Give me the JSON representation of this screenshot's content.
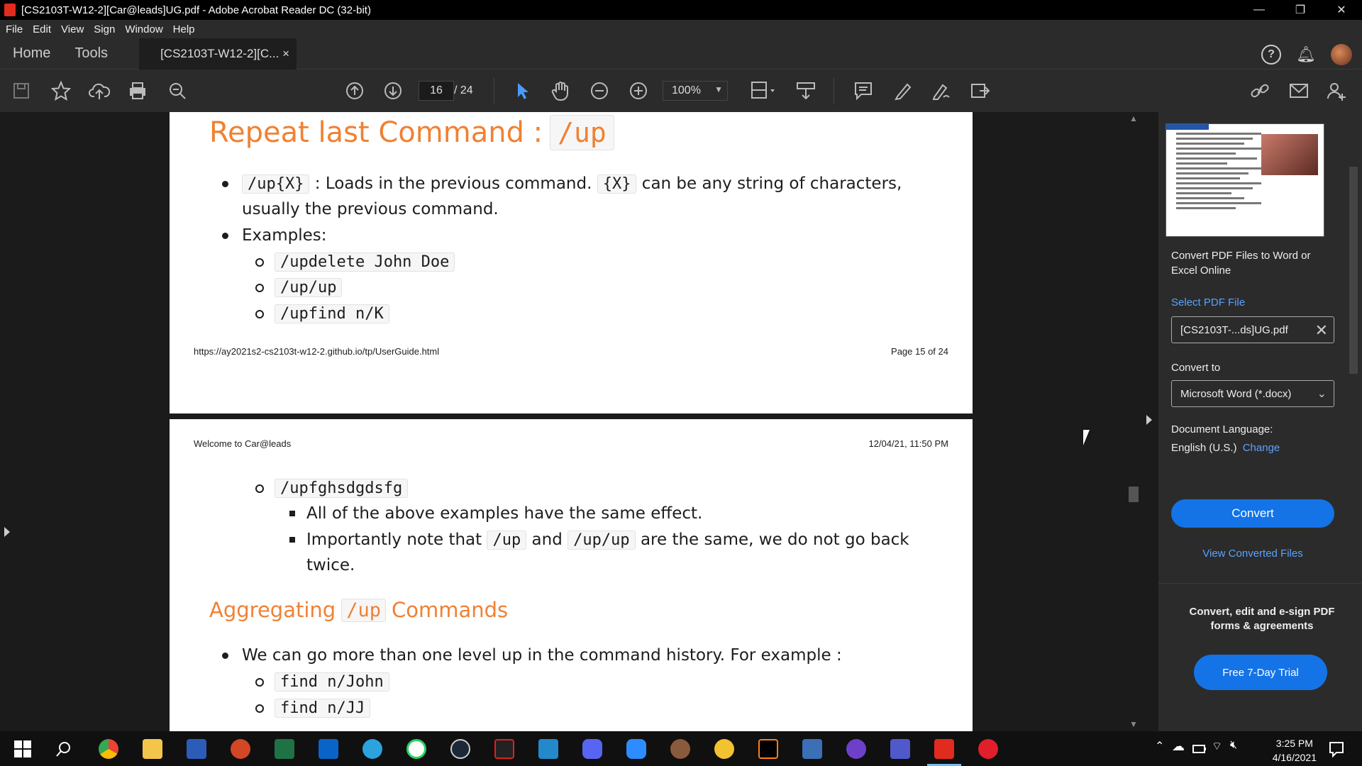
{
  "window": {
    "title": "[CS2103T-W12-2][Car@leads]UG.pdf - Adobe Acrobat Reader DC (32-bit)",
    "minimize": "—",
    "restore": "❐",
    "close": "✕"
  },
  "menu": [
    "File",
    "Edit",
    "View",
    "Sign",
    "Window",
    "Help"
  ],
  "tabs": {
    "home": "Home",
    "tools": "Tools",
    "document": "[CS2103T-W12-2][C...",
    "close": "×"
  },
  "toolbar": {
    "current_page": "16",
    "total_pages": "/ 24",
    "zoom": "100%"
  },
  "page1": {
    "heading_text": "Repeat last Command :",
    "heading_code": "/up",
    "bullet1_code": "/up{X}",
    "bullet1_text_a": ": Loads in the previous command.",
    "bullet1_code2": "{X}",
    "bullet1_text_b": "can be any string of characters,",
    "bullet1_line2": "usually the previous command.",
    "bullet2": "Examples:",
    "examples": [
      "/updelete John Doe",
      "/up/up",
      "/upfind n/K"
    ],
    "footer_url": "https://ay2021s2-cs2103t-w12-2.github.io/tp/UserGuide.html",
    "footer_page": "Page 15 of 24"
  },
  "page2": {
    "header_left": "Welcome to Car@leads",
    "header_right": "12/04/21, 11:50 PM",
    "example4": "/upfghsdgdsfg",
    "note1": "All of the above examples have the same effect.",
    "note2_a": "Importantly note that",
    "note2_code1": "/up",
    "note2_and": "and",
    "note2_code2": "/up/up",
    "note2_b": "are the same, we do not go back",
    "note2_line2": "twice.",
    "heading2_a": "Aggregating",
    "heading2_code": "/up",
    "heading2_b": "Commands",
    "bullet": "We can go more than one level up in the command history. For example :",
    "sub_examples": [
      "find n/John",
      "find n/JJ"
    ]
  },
  "right_pane": {
    "promo_title": "Convert PDF Files to Word or Excel Online",
    "select_label": "Select PDF File",
    "file_name": "[CS2103T-...ds]UG.pdf",
    "convert_to_label": "Convert to",
    "convert_to_value": "Microsoft Word (*.docx)",
    "language_label": "Document Language:",
    "language_value": "English (U.S.)",
    "change_link": "Change",
    "convert_button": "Convert",
    "view_converted": "View Converted Files",
    "bottom_promo": "Convert, edit and e-sign PDF forms & agreements",
    "trial_button": "Free 7-Day Trial"
  },
  "taskbar": {
    "time": "3:25 PM",
    "date": "4/16/2021"
  },
  "colors": {
    "accent_blue": "#1473e6",
    "heading_orange": "#f08133",
    "link_blue": "#5aa2ff"
  }
}
